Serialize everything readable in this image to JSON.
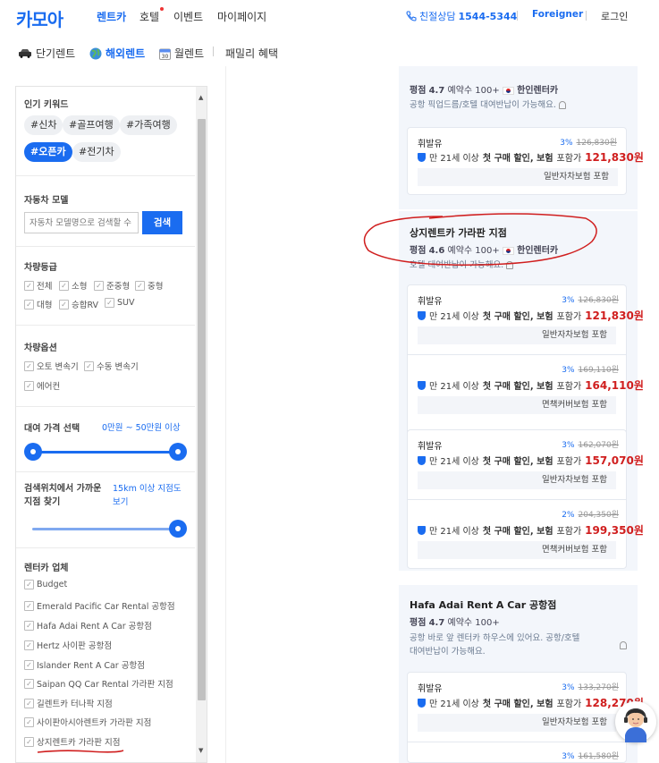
{
  "header": {
    "logo": "카모아",
    "nav": [
      "렌트카",
      "호텔",
      "이벤트",
      "마이페이지"
    ],
    "phone_prefix": "친절상담",
    "phone_number": "1544-5344",
    "foreigner": "Foreigner",
    "login": "로그인"
  },
  "subnav": [
    "단기렌트",
    "해외렌트",
    "월렌트",
    "패밀리 혜택"
  ],
  "sidebar": {
    "keywords_title": "인기 키워드",
    "keywords": [
      "#신차",
      "#골프여행",
      "#가족여행",
      "#오픈카",
      "#전기차"
    ],
    "model_title": "자동차 모델",
    "model_placeholder": "자동차 모델명으로 검색할 수",
    "search_button": "검색",
    "grade_title": "차량등급",
    "grades": [
      "전체",
      "소형",
      "준중형",
      "중형",
      "대형",
      "승합RV",
      "SUV"
    ],
    "options_title": "차량옵션",
    "options": [
      "오토 변속기",
      "수동 변속기",
      "에어컨"
    ],
    "price_title": "대여 가격 선택",
    "price_min": "0만원",
    "price_tilde": "~",
    "price_max": "50만원 이상",
    "distance_title_1": "검색위치에서 가까운",
    "distance_title_2": "지점 찾기",
    "distance_value_1": "15km 이상 지점도",
    "distance_value_2": "보기",
    "vendor_title": "렌터카 업체",
    "vendors": [
      "Budget",
      "Emerald Pacific Car Rental 공항점",
      "Hafa Adai Rent A Car 공항점",
      "Hertz 사이판 공항점",
      "Islander Rent A Car 공항점",
      "Saipan QQ Car Rental 가라판 지점",
      "길렌트카 터나팍 지점",
      "사이판아시아렌트카 가라판 지점",
      "상지렌트카 가라판 지점"
    ]
  },
  "shops": {
    "top": {
      "rating_label": "평점",
      "rating": "4.7",
      "bookings": "예약수 100+",
      "vendor": "한인렌터카",
      "note": "공항 픽업드름/호텔 대여반납이 가능해요."
    },
    "sangji": {
      "name": "상지렌트카 가라판 지점",
      "rating_label": "평점",
      "rating": "4.6",
      "bookings": "예약수 100+",
      "vendor": "한인렌터카",
      "note": "호텔 대여반납이 가능해요."
    },
    "hafa": {
      "name": "Hafa Adai Rent A Car 공항점",
      "rating_label": "평점",
      "rating": "4.7",
      "bookings": "예약수 100+",
      "note_1": "공항 바로 앞 렌터카 하우스에 있어요. 공항/호텔",
      "note_2": "대여반납이 가능해요."
    }
  },
  "offer_common": {
    "fuel": "휘발유",
    "age": "만 21세 이상",
    "first": "첫 구매 할인, 보험",
    "included": "포함가"
  },
  "offers": [
    {
      "discount": "3%",
      "original": "126,830원",
      "price": "121,830원",
      "insurance": "일반자차보험 포함"
    },
    {
      "discount": "3%",
      "original": "126,830원",
      "price": "121,830원",
      "insurance": "일반자차보험 포함"
    },
    {
      "discount": "3%",
      "original": "169,110원",
      "price": "164,110원",
      "insurance": "면책커버보험 포함"
    },
    {
      "discount": "3%",
      "original": "162,070원",
      "price": "157,070원",
      "insurance": "일반자차보험 포함"
    },
    {
      "discount": "2%",
      "original": "204,350원",
      "price": "199,350원",
      "insurance": "면책커버보험 포함"
    },
    {
      "discount": "3%",
      "original": "133,270원",
      "price": "128,270원",
      "insurance": "일반자차보험 포함"
    },
    {
      "discount": "3%",
      "original": "161,580원"
    }
  ],
  "colors": {
    "accent": "#1a6cf0",
    "price": "#d01e1e",
    "annotation": "#d01e1e"
  }
}
